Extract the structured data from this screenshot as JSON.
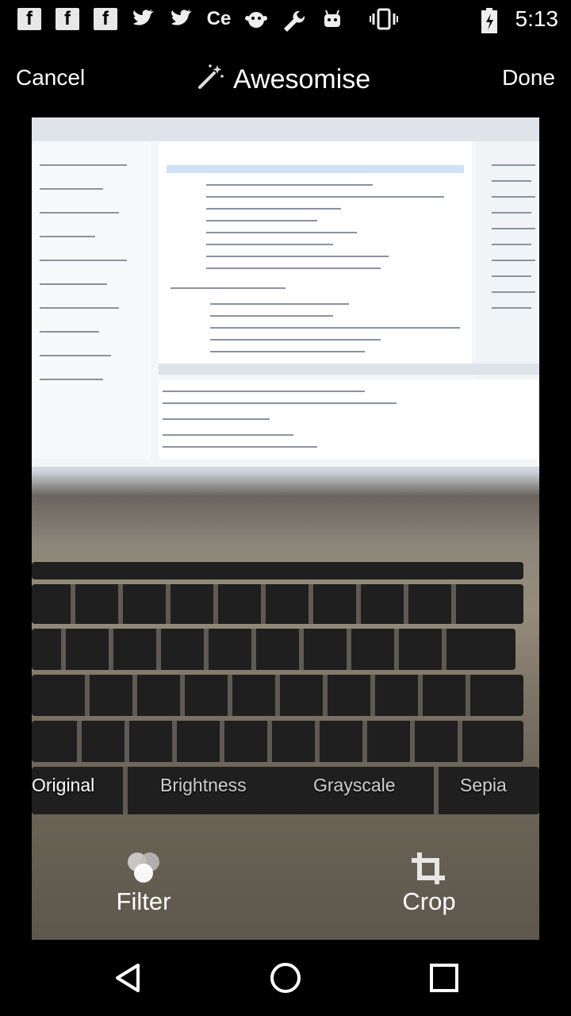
{
  "status_bar": {
    "time": "5:13",
    "left_icons": [
      "facebook-icon",
      "facebook-icon",
      "facebook-icon",
      "twitter-icon",
      "twitter-icon",
      "cc-icon",
      "monkey-icon",
      "wrench-icon",
      "android-icon"
    ],
    "right_icons": [
      "vibrate-icon",
      "battery-charging-icon"
    ]
  },
  "header": {
    "cancel_label": "Cancel",
    "title": "Awesomise",
    "done_label": "Done"
  },
  "filters": [
    {
      "label": "Original",
      "active": true
    },
    {
      "label": "Brightness",
      "active": false
    },
    {
      "label": "Grayscale",
      "active": false
    },
    {
      "label": "Sepia",
      "active": false
    }
  ],
  "tools": {
    "filter_label": "Filter",
    "crop_label": "Crop"
  },
  "navigation": [
    "back-icon",
    "home-icon",
    "recents-icon"
  ]
}
